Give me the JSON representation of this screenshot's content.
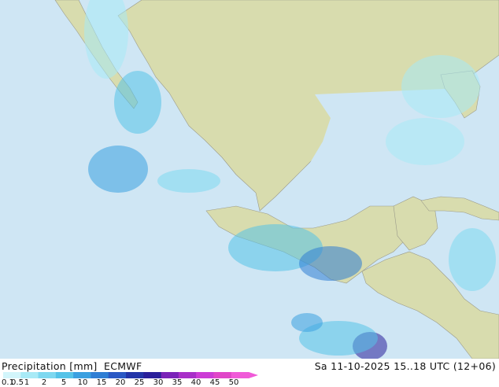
{
  "footer": {
    "title": "Precipitation [mm]",
    "model": "ECMWF",
    "timestamp": "Sa 11-10-2025 15..18 UTC (12+06)"
  },
  "legend": {
    "ticks": [
      "0.1",
      "0.5",
      "1",
      "2",
      "5",
      "10",
      "15",
      "20",
      "25",
      "30",
      "35",
      "40",
      "45",
      "50"
    ],
    "colors": [
      "#d2f5fb",
      "#a8eaf6",
      "#7ed8f0",
      "#55c3e8",
      "#3ba0e0",
      "#2f7ed4",
      "#2a58c4",
      "#2335a8",
      "#2a1f9a",
      "#7a23b8",
      "#a82fc8",
      "#cc3cd6",
      "#e046c8",
      "#f05ad8"
    ]
  },
  "map": {
    "ocean_color": "#cfe6f4",
    "land_color": "#d6dcb0"
  }
}
